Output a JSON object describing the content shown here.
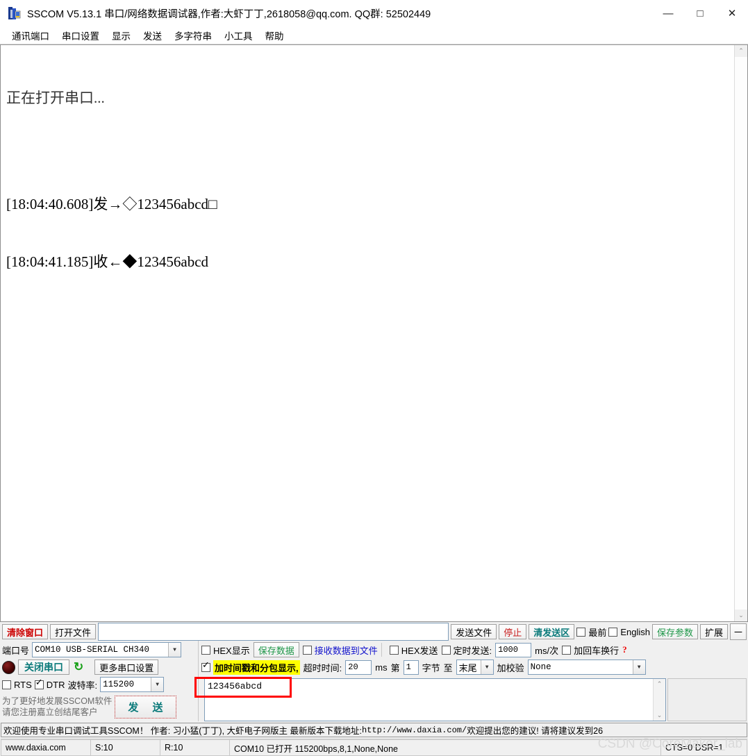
{
  "window": {
    "title": "SSCOM V5.13.1 串口/网络数据调试器,作者:大虾丁丁,2618058@qq.com. QQ群: 52502449",
    "minimize": "—",
    "maximize": "□",
    "close": "✕"
  },
  "menu": {
    "items": [
      {
        "label": "通讯端口"
      },
      {
        "label": "串口设置"
      },
      {
        "label": "显示"
      },
      {
        "label": "发送"
      },
      {
        "label": "多字符串"
      },
      {
        "label": "小工具"
      },
      {
        "label": "帮助"
      }
    ]
  },
  "log": {
    "lines": [
      "正在打开串口...",
      "",
      "[18:04:40.608]发→◇123456abcd□",
      "[18:04:41.185]收←◆123456abcd"
    ],
    "scroll_up": "⌃",
    "scroll_down": "⌄"
  },
  "toolbar": {
    "clear_window": "清除窗口",
    "open_file": "打开文件",
    "file_path": "",
    "send_file": "发送文件",
    "stop": "停止",
    "clear_send": "清发送区",
    "topmost_label": "最前",
    "topmost_checked": false,
    "english_label": "English",
    "english_checked": false,
    "save_params": "保存参数",
    "extend": "扩展",
    "minus": "─"
  },
  "serial": {
    "port_label": "端口号",
    "port_value": "COM10 USB-SERIAL CH340",
    "close_port": "关闭串口",
    "refresh_icon": "↻",
    "more_settings": "更多串口设置",
    "rts_label": "RTS",
    "rts_checked": false,
    "dtr_label": "DTR",
    "dtr_checked": true,
    "baud_label": "波特率:",
    "baud_value": "115200",
    "promo": "为了更好地发展SSCOM软件\n请您注册嘉立创结尾客户",
    "send_button": "发 送"
  },
  "options": {
    "hex_display_label": "HEX显示",
    "hex_display_checked": false,
    "save_data": "保存数据",
    "recv_to_file_label": "接收数据到文件",
    "recv_to_file_checked": false,
    "hex_send_label": "HEX发送",
    "hex_send_checked": false,
    "timed_send_label": "定时发送:",
    "timed_send_checked": false,
    "timed_send_value": "1000",
    "ms_per_time": "ms/次",
    "crlf_label": "加回车换行",
    "crlf_checked": false,
    "help_mark": "?",
    "timestamp_label": "加时间戳和分包显示,",
    "timestamp_checked": true,
    "timeout_label": "超时时间:",
    "timeout_value": "20",
    "timeout_unit": "ms",
    "byte_prefix": "第",
    "byte_start": "1",
    "byte_label": "字节",
    "byte_to": "至",
    "byte_end": "末尾",
    "checksum_label": "加校验",
    "checksum_value": "None"
  },
  "send_area": {
    "value": "123456abcd"
  },
  "marquee": {
    "text_a": "欢迎使用专业串口调试工具SSCOM！  作者: 习小猛(丁丁), 大虾电子网版主  最新版本下载地址: ",
    "url": "http://www.daxia.com/",
    "text_b": " 欢迎提出您的建议! 请将建议发到26"
  },
  "status": {
    "site": "www.daxia.com",
    "sent": "S:10",
    "received": "R:10",
    "connection": "COM10 已打开  115200bps,8,1,None,None",
    "signals": "CTS=0 DSR=1"
  },
  "watermark": {
    "text": "CSDN @CoreMaker_lab"
  }
}
